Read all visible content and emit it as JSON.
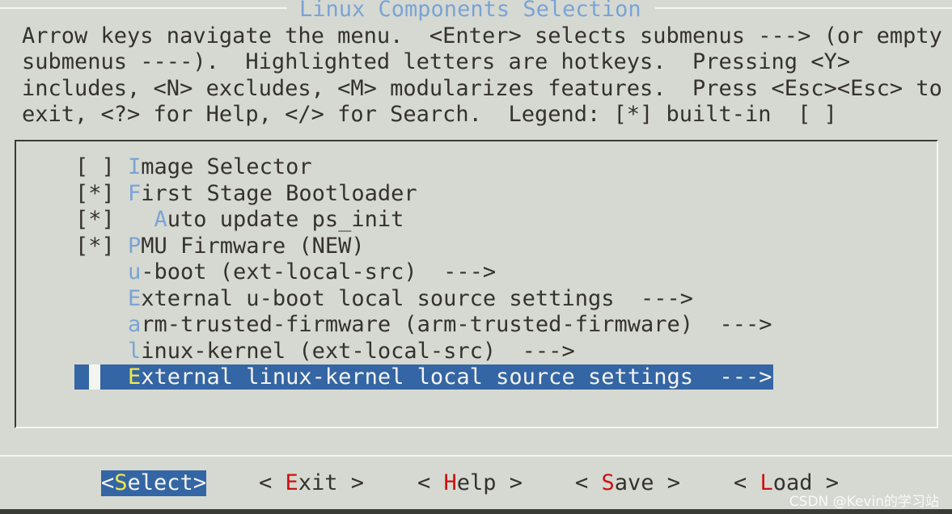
{
  "window": {
    "title": "Linux Components Selection"
  },
  "help_lines": [
    "Arrow keys navigate the menu.  <Enter> selects submenus ---> (or empty",
    "submenus ----).  Highlighted letters are hotkeys.  Pressing <Y>",
    "includes, <N> excludes, <M> modularizes features.  Press <Esc><Esc> to",
    "exit, <?> for Help, </> for Search.  Legend: [*] built-in  [ ]"
  ],
  "menu": {
    "items": [
      {
        "state": "[ ]",
        "indent": "",
        "hotkey": "I",
        "rest": "mage Selector"
      },
      {
        "state": "[*]",
        "indent": "",
        "hotkey": "F",
        "rest": "irst Stage Bootloader"
      },
      {
        "state": "[*]",
        "indent": "  ",
        "hotkey": "A",
        "rest": "uto update ps_init"
      },
      {
        "state": "[*]",
        "indent": "",
        "hotkey": "P",
        "rest": "MU Firmware (NEW)"
      },
      {
        "state": "",
        "indent": "",
        "hotkey": "u",
        "rest": "-boot (ext-local-src)  --->"
      },
      {
        "state": "",
        "indent": "",
        "hotkey": "E",
        "rest": "xternal u-boot local source settings  --->"
      },
      {
        "state": "",
        "indent": "",
        "hotkey": "a",
        "rest": "rm-trusted-firmware (arm-trusted-firmware)  --->"
      },
      {
        "state": "",
        "indent": "",
        "hotkey": "l",
        "rest": "inux-kernel (ext-local-src)  --->"
      },
      {
        "state": "",
        "indent": "",
        "hotkey": "E",
        "rest": "xternal linux-kernel local source settings  --->",
        "selected": true
      }
    ]
  },
  "buttons": [
    {
      "pre": "<",
      "hotkey": "S",
      "post": "elect>",
      "active": true
    },
    {
      "pre": "< ",
      "hotkey": "E",
      "post": "xit >"
    },
    {
      "pre": "< ",
      "hotkey": "H",
      "post": "elp >"
    },
    {
      "pre": "< ",
      "hotkey": "S",
      "post": "ave >"
    },
    {
      "pre": "< ",
      "hotkey": "L",
      "post": "oad >"
    }
  ],
  "watermark": "CSDN @Kevin的学习站",
  "colors": {
    "background": "#d6d9d1",
    "hotkey": "#7aa3d6",
    "selection": "#3465a4",
    "selected_hotkey": "#f3e84a",
    "button_hotkey": "#cc1111"
  }
}
